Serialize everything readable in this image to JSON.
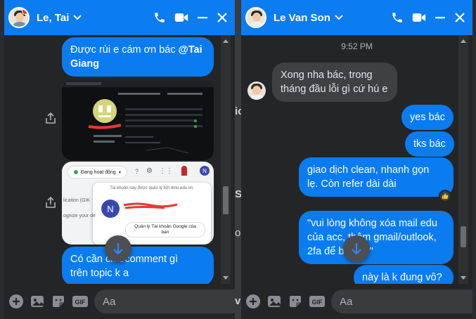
{
  "background": {
    "fragments": [
      "ic",
      "S",
      "ou",
      "vi"
    ]
  },
  "left_chat": {
    "header": {
      "name": "Le, Tai"
    },
    "messages": {
      "m1_line1": "Được rùi e cám ơn bác ",
      "m1_mention": "@Tai Giang",
      "m1_line2": "",
      "m3_line1": "Có cần cmt/comment gì",
      "m3_line2": "trên topic k a"
    },
    "screenshot2": {
      "status": "Đang hoạt động",
      "domain_text": "Tài khoản này được quản lý bởi dntu.edu.vn.",
      "avatar_letter": "N",
      "manage_button": "Quản lý Tài khoản Google của bạn",
      "side_text1": "lication (GIK",
      "side_text2": "ognize your de"
    },
    "composer": {
      "placeholder": "Aa"
    }
  },
  "right_chat": {
    "header": {
      "name": "Le Van Son"
    },
    "time": "9:52 PM",
    "messages": {
      "in1_line1": "Xong nha bác, trong",
      "in1_line2": "tháng đầu lỗi gì cứ hú e",
      "out1": "yes bác",
      "out2": "tks bác",
      "out3_line1": "giao dịch clean, nhanh gọn",
      "out3_line2": "lẹ. Còn refer dài dài",
      "out4_line1": "\"vui lòng không xóa mail edu",
      "out4_line2": "của acc, thêm gmail/outlook,",
      "out4_line3": "2fa để báo hộ\"",
      "out5": "này là k đung vô?"
    },
    "composer": {
      "placeholder": "Aa"
    }
  },
  "colors": {
    "header_blue": "#0c7cf1",
    "bubble_blue": "#0a7cf0",
    "bubble_gray": "#3e4042",
    "panel_bg": "#242526"
  }
}
